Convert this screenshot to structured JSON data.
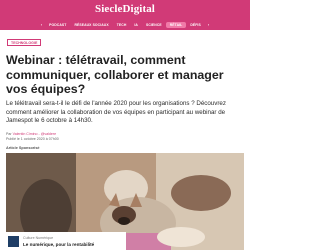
{
  "header": {
    "logo": "SiecleDigital",
    "nav": [
      "PODCAST",
      "RÉSEAUX SOCIAUX",
      "TECH",
      "IA",
      "SCIENCE",
      "RÉTAIL",
      "DÉFIS"
    ],
    "nav_active": "RÉTAIL",
    "nav_ext": "pas · …",
    "icon_prev": "‹",
    "icon_next": "›"
  },
  "article": {
    "tag": "TECHNOLOGIE",
    "title": "Webinar : télétravail, comment communiquer, collaborer et manager vos équipes?",
    "lede": "Le télétravail sera-t-il le défi de l'année 2020 pour les organisations ? Découvrez comment améliorer la collaboration de vos équipes en participant au webinar de Jamespot le 6 octobre à 14h30.",
    "byline_prefix": "Par",
    "author": "Valentin Cimino - @valdere",
    "date": "Publié le 1 octobre 2020 à 07h00",
    "sponsored": "Article Sponsorisé"
  },
  "ad": {
    "brand": "Culture Numérique",
    "headline": "Le numérique, pour la rentabilité"
  },
  "colors": {
    "accent": "#d13a77",
    "pill": "#f07aa8",
    "title": "#222222"
  }
}
